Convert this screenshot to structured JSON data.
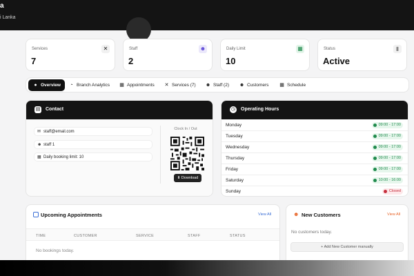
{
  "header": {
    "brand": "a",
    "location": "i Lanka"
  },
  "stats": [
    {
      "label": "Services",
      "value": "7",
      "icon": "tools-icon",
      "glyph": "✕",
      "color": "#222",
      "bg": "#f1f1f1"
    },
    {
      "label": "Staff",
      "value": "2",
      "icon": "people-icon",
      "glyph": "☻",
      "color": "#5a45d6",
      "bg": "#ebe8fb"
    },
    {
      "label": "Daily Limit",
      "value": "10",
      "icon": "calendar-icon",
      "glyph": "▦",
      "color": "#1f8a4c",
      "bg": "#e3f4e9"
    },
    {
      "label": "Status",
      "value": "Active",
      "icon": "signal-icon",
      "glyph": "▮",
      "color": "#888",
      "bg": "#f1f1f1"
    }
  ],
  "tabs": [
    {
      "label": "Overview",
      "icon": "check-circle-icon",
      "glyph": "●"
    },
    {
      "label": "Branch Analytics",
      "icon": "pie-chart-icon",
      "glyph": "◔"
    },
    {
      "label": "Appointments",
      "icon": "calendar-icon",
      "glyph": "▦"
    },
    {
      "label": "Services (7)",
      "icon": "tools-icon",
      "glyph": "✕"
    },
    {
      "label": "Staff (2)",
      "icon": "people-icon",
      "glyph": "☻"
    },
    {
      "label": "Customers",
      "icon": "users-icon",
      "glyph": "☻"
    },
    {
      "label": "Schedule",
      "icon": "calendar-icon",
      "glyph": "▦"
    }
  ],
  "contact": {
    "title": "Contact",
    "email": "staff@email.com",
    "name": "staff 1",
    "limit": "Daily booking limit: 10",
    "qr_label": "Clock In / Out",
    "download_label": "Download"
  },
  "hours": {
    "title": "Operating Hours",
    "rows": [
      {
        "day": "Monday",
        "time": "09:00 - 17:00",
        "open": true
      },
      {
        "day": "Tuesday",
        "time": "09:00 - 17:00",
        "open": true
      },
      {
        "day": "Wednesday",
        "time": "09:00 - 17:00",
        "open": true
      },
      {
        "day": "Thursday",
        "time": "09:00 - 17:00",
        "open": true
      },
      {
        "day": "Friday",
        "time": "09:00 - 17:00",
        "open": true
      },
      {
        "day": "Saturday",
        "time": "10:00 - 16:00",
        "open": true
      },
      {
        "day": "Sunday",
        "time": "Closed",
        "open": false
      }
    ]
  },
  "appointments": {
    "title": "Upcoming Appointments",
    "view_all": "View All",
    "columns": [
      "TIME",
      "CUSTOMER",
      "SERVICE",
      "STAFF",
      "STATUS"
    ],
    "empty": "No bookings today."
  },
  "customers": {
    "title": "New Customers",
    "view_all": "View All",
    "empty": "No customers today.",
    "add_label": "+ Add New Customer manually"
  }
}
